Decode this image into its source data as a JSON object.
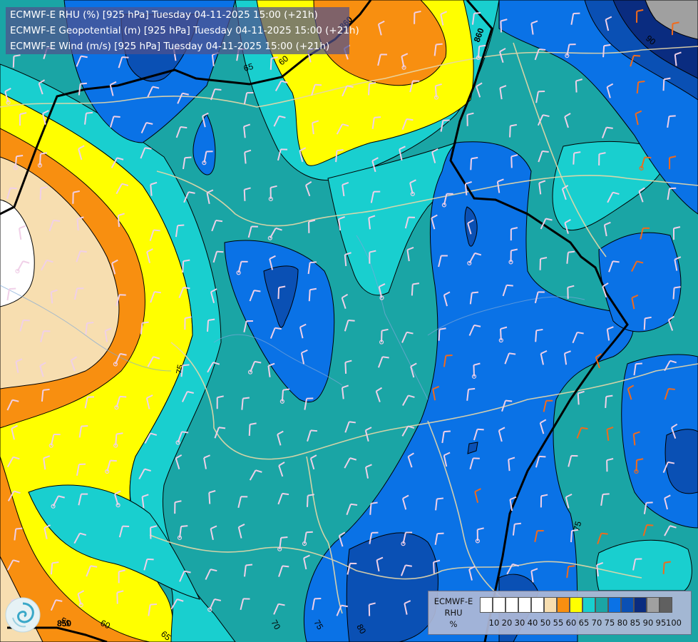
{
  "header": {
    "line1": "ECMWF-E RHU (%) [925 hPa] Tuesday 04-11-2025 15:00 (+21h)",
    "line2": "ECMWF-E Geopotential (m) [925 hPa] Tuesday 04-11-2025 15:00 (+21h)",
    "line3": "ECMWF-E Wind (m/s) [925 hPa] Tuesday 04-11-2025 15:00 (+21h)"
  },
  "legend": {
    "label_line1": "ECMWF-E",
    "label_line2": "RHU",
    "label_line3": "%",
    "colors": [
      "#ffffff",
      "#ffffff",
      "#ffffff",
      "#ffffff",
      "#ffffff",
      "#f7deb0",
      "#f88f10",
      "#ffff00",
      "#19cfcf",
      "#1aa5a5",
      "#0a72e6",
      "#0a50b4",
      "#0a2c80",
      "#a0a0a0",
      "#606060"
    ],
    "ticks": [
      "10",
      "20",
      "30",
      "40",
      "50",
      "55",
      "60",
      "65",
      "70",
      "75",
      "80",
      "85",
      "90",
      "95",
      "100"
    ]
  },
  "contours": {
    "geopotential_labels": [
      "860",
      "860",
      "850"
    ],
    "rhu_labels": [
      "65",
      "60",
      "75",
      "70",
      "75",
      "80",
      "55",
      "60",
      "65",
      "90",
      "75"
    ]
  },
  "fill_colors": {
    "rhu_50": "#f7deb0",
    "rhu_55": "#f88f10",
    "rhu_60": "#ffff00",
    "rhu_65": "#19cfcf",
    "rhu_70": "#1aa5a5",
    "rhu_75": "#0a72e6",
    "rhu_80": "#0a50b4",
    "rhu_85": "#0a2c80",
    "rhu_90": "#a0a0a0"
  },
  "logo_icon": "ecmwf-swirl-icon"
}
